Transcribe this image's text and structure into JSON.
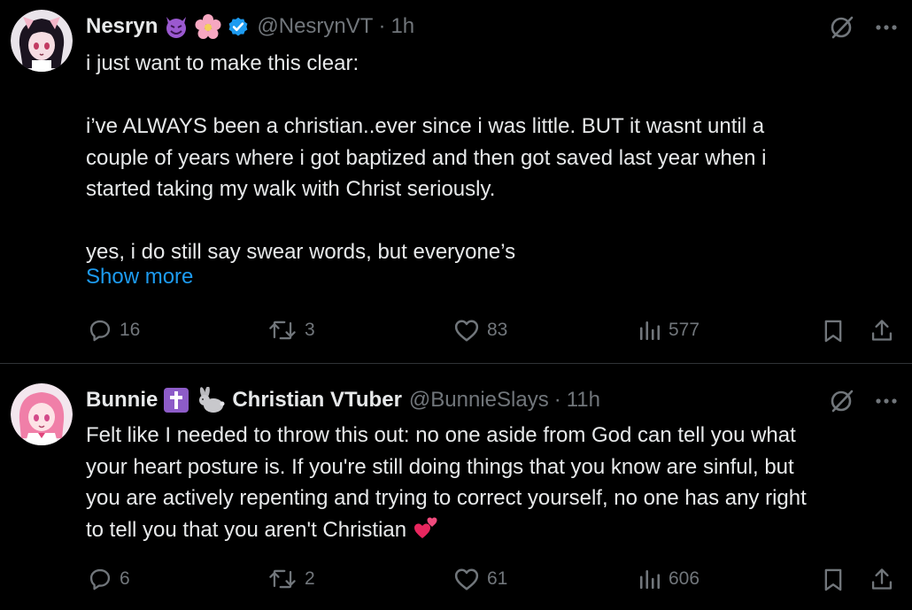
{
  "posts": [
    {
      "display_name": "Nesryn",
      "emojis": [
        "smiling-devil-emoji",
        "cherry-blossom-emoji"
      ],
      "verified": true,
      "handle": "@NesrynVT",
      "time": "1h",
      "text": "i just want to make this clear:\n\ni’ve ALWAYS been a christian..ever since i was little. BUT it wasnt until a\ncouple of years where i got baptized and then got saved last year when i\nstarted taking my walk with Christ seriously.\n\nyes, i do still say swear words, but everyone’s",
      "show_more": "Show more",
      "replies": "16",
      "reposts": "3",
      "likes": "83",
      "views": "577"
    },
    {
      "display_name": "Bunnie",
      "name_suffix": "Christian VTuber",
      "emojis": [
        "latin-cross-emoji",
        "rabbit-emoji"
      ],
      "verified": false,
      "handle": "@BunnieSlays",
      "time": "11h",
      "text": "Felt like I needed to throw this out: no one aside from God can tell you what\nyour heart posture is. If you're still doing things that you know are sinful, but\nyou are actively repenting and trying to correct yourself, no one has any right\nto tell you that you aren't Christian",
      "trailing_emoji": "two-hearts-emoji",
      "replies": "6",
      "reposts": "2",
      "likes": "61",
      "views": "606"
    }
  ],
  "colors": {
    "background": "#000000",
    "text": "#e7e9ea",
    "muted": "#71767b",
    "link": "#1d9bf0",
    "divider": "#2f3336",
    "verified": "#1d9bf0"
  }
}
